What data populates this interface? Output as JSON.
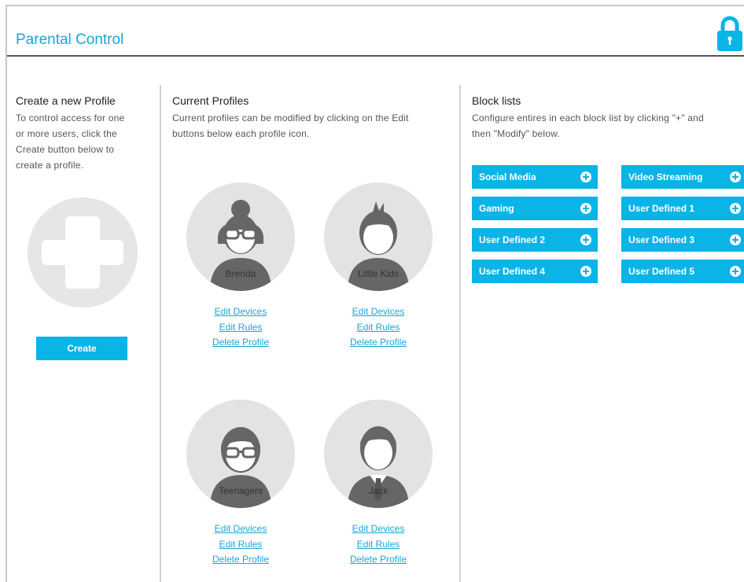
{
  "header": {
    "title": "Parental Control",
    "lock_icon": "lock-icon"
  },
  "create": {
    "title": "Create a new Profile",
    "desc_lines": [
      "To control access for one",
      "or more users, click the",
      "Create button below to",
      "create a profile."
    ],
    "button_label": "Create"
  },
  "profiles": {
    "title": "Current Profiles",
    "desc_lines": [
      "Current profiles can be modified by clicking on the Edit",
      "buttons below each profile icon."
    ],
    "items": [
      {
        "name": "Brenda",
        "avatar": "woman-glasses-icon",
        "links": [
          "Edit Devices",
          "Edit Rules",
          "Delete Profile"
        ]
      },
      {
        "name": "Little Kids",
        "avatar": "child-icon",
        "links": [
          "Edit Devices",
          "Edit Rules",
          "Delete Profile"
        ]
      },
      {
        "name": "Teenagers",
        "avatar": "teen-glasses-icon",
        "links": [
          "Edit Devices",
          "Edit Rules",
          "Delete Profile"
        ]
      },
      {
        "name": "Jack",
        "avatar": "man-tie-icon",
        "links": [
          "Edit Devices",
          "Edit Rules",
          "Delete Profile"
        ]
      }
    ]
  },
  "blocklists": {
    "title": "Block lists",
    "desc_lines": [
      "Configure entires in each block list by clicking \"+\" and",
      "then \"Modify\" below."
    ],
    "items": [
      "Social Media",
      "Video Streaming",
      "Gaming",
      "User Defined 1",
      "User Defined 2",
      "User Defined 3",
      "User Defined 4",
      "User Defined 5"
    ]
  },
  "colors": {
    "accent": "#0ab4e6",
    "link": "#1aa6d8",
    "avatar_bg": "#e3e3e3",
    "avatar_fg": "#666666"
  }
}
